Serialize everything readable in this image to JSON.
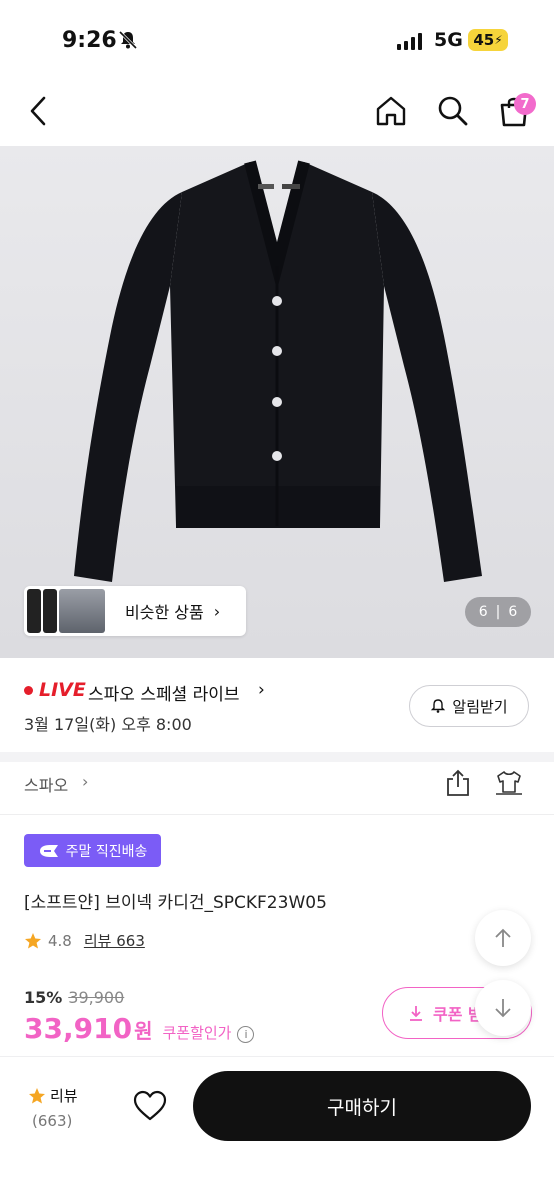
{
  "status": {
    "time": "9:26",
    "network": "5G",
    "battery": "45"
  },
  "nav": {
    "cart_count": "7"
  },
  "gallery": {
    "similar_label": "비슷한 상품",
    "page_current": "6",
    "page_total": "6"
  },
  "live": {
    "tag": "LIVE",
    "title": "스파오 스페셜 라이브",
    "datetime": "3월 17일(화) 오후 8:00",
    "alarm_label": "알림받기"
  },
  "brand": {
    "name": "스파오"
  },
  "product": {
    "shipping_badge": "주말 직진배송",
    "name": "[소프트얀] 브이넥 카디건_SPCKF23W05",
    "rating": "4.8",
    "review_label": "리뷰 663",
    "discount_rate": "15%",
    "original_price": "39,900",
    "price": "33,910",
    "currency": "원",
    "coupon_note": "쿠폰할인가",
    "coupon_button": "쿠폰 받"
  },
  "bottom": {
    "review_label": "리뷰",
    "review_count": "(663)",
    "buy_label": "구매하기"
  },
  "colors": {
    "accent": "#f263c5",
    "badge_purple": "#7b5cf6",
    "live_red": "#e51e2b",
    "cart_badge": "#f26bcc"
  }
}
